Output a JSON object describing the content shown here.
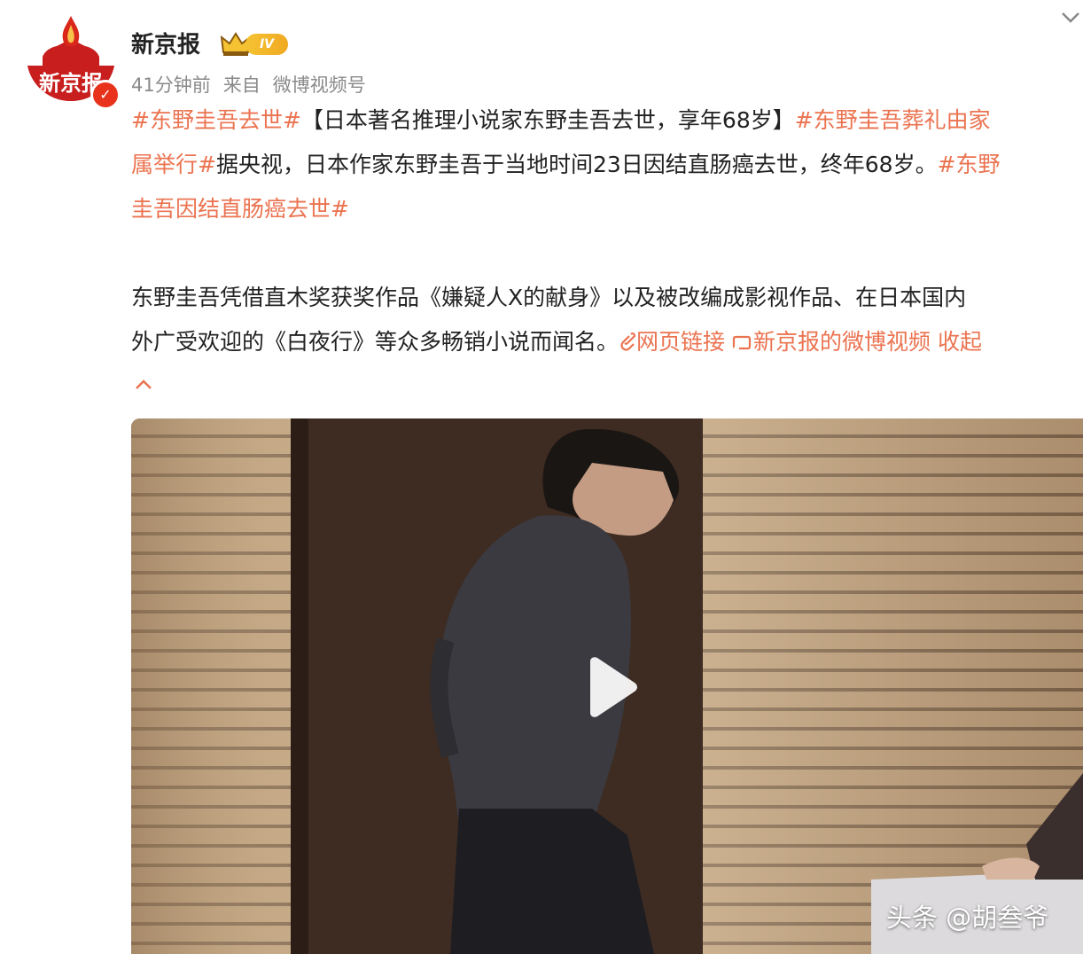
{
  "post": {
    "author": "新京报",
    "avatar_text": "新京报",
    "vip_level": "IV",
    "time": "41分钟前",
    "source_prefix": "来自",
    "source": "微博视频号"
  },
  "content": {
    "p1_line1": [
      {
        "t": "#东野圭吾去世#",
        "tag": true
      },
      {
        "t": "【日本著名推理小说家东野圭吾去世，享年68岁】",
        "tag": false
      },
      {
        "t": "#东野圭吾葬礼由家",
        "tag": true
      }
    ],
    "p1_line2": [
      {
        "t": "属举行#",
        "tag": true
      },
      {
        "t": "据央视，日本作家东野圭吾于当地时间23日因结直肠癌去世，终年68岁。",
        "tag": false
      },
      {
        "t": "#东野",
        "tag": true
      }
    ],
    "p1_line3": [
      {
        "t": "圭吾因结直肠癌去世#",
        "tag": true
      }
    ],
    "p2_line1": "东野圭吾凭借直木奖获奖作品《嫌疑人X的献身》以及被改编成影视作品、在日本国内",
    "p2_line2": "外广受欢迎的《白夜行》等众多畅销小说而闻名。",
    "link_web": "网页链接",
    "link_video": "新京报的微博视频",
    "collapse": "收起"
  },
  "video": {
    "watermark": "头条 @胡叁爷"
  },
  "icons": {
    "expand": "chevron-down-icon",
    "collapse": "chevron-up-icon",
    "play": "play-icon",
    "link": "link-icon",
    "video": "video-icon",
    "verified": "verified-icon",
    "vip": "crown-icon"
  },
  "colors": {
    "tag": "#eb7350",
    "verified": "#e8321b",
    "vip": "#f0a922"
  }
}
